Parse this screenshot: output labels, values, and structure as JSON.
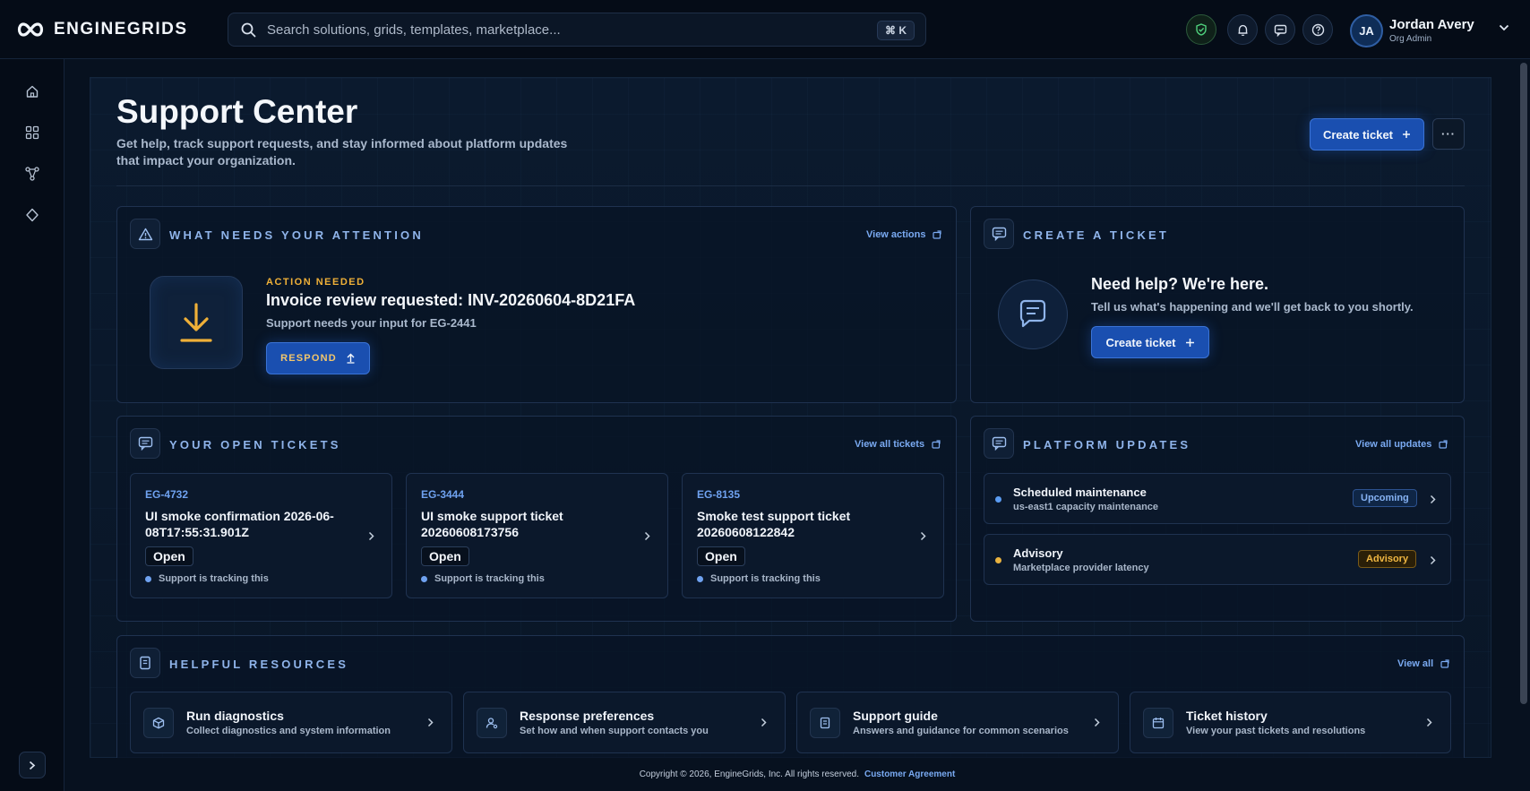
{
  "brand": {
    "name": "ENGINEGRIDS",
    "logo_icon": "infinity-logo-icon"
  },
  "search": {
    "placeholder": "Search solutions, grids, templates, marketplace...",
    "shortcut": "⌘ K"
  },
  "topbar_icons": [
    "shield-check-icon",
    "bell-icon",
    "message-icon",
    "help-icon"
  ],
  "user": {
    "initials": "JA",
    "name": "Jordan Avery",
    "role": "Org Admin"
  },
  "sidebar": {
    "items": [
      "home-icon",
      "grid-icon",
      "workflow-icon",
      "marketplace-icon"
    ],
    "expand_icon": "chevron-right-icon"
  },
  "page": {
    "title": "Support Center",
    "subtitle": "Get help, track support requests, and stay informed about platform updates that impact your organization.",
    "create_ticket": "Create ticket",
    "more": "···"
  },
  "attention": {
    "title": "WHAT NEEDS YOUR ATTENTION",
    "link": "View actions",
    "eyebrow": "ACTION NEEDED",
    "headline": "Invoice review requested: INV-20260604-8D21FA",
    "detail": "Support needs your input for EG-2441",
    "respond": "RESPOND"
  },
  "create": {
    "title": "CREATE A TICKET",
    "headline": "Need help? We're here.",
    "detail": "Tell us what's happening and we'll get back to you shortly.",
    "button": "Create ticket"
  },
  "tickets": {
    "title": "YOUR OPEN TICKETS",
    "link": "View all tickets",
    "items": [
      {
        "id": "EG-4732",
        "title": "UI smoke confirmation 2026-06-08T17:55:31.901Z",
        "status": "Open",
        "note": "Support is tracking this"
      },
      {
        "id": "EG-3444",
        "title": "UI smoke support ticket 20260608173756",
        "status": "Open",
        "note": "Support is tracking this"
      },
      {
        "id": "EG-8135",
        "title": "Smoke test support ticket 20260608122842",
        "status": "Open",
        "note": "Support is tracking this"
      }
    ]
  },
  "updates": {
    "title": "PLATFORM UPDATES",
    "link": "View all updates",
    "items": [
      {
        "title": "Scheduled maintenance",
        "detail": "us-east1 capacity maintenance",
        "badge": "Upcoming",
        "color": "#5b9cf2"
      },
      {
        "title": "Advisory",
        "detail": "Marketplace provider latency",
        "badge": "Advisory",
        "color": "#e9b23f"
      }
    ]
  },
  "resources": {
    "title": "HELPFUL RESOURCES",
    "link": "View all",
    "items": [
      {
        "title": "Run diagnostics",
        "detail": "Collect diagnostics and system information",
        "icon": "cube-icon"
      },
      {
        "title": "Response preferences",
        "detail": "Set how and when support contacts you",
        "icon": "user-settings-icon"
      },
      {
        "title": "Support guide",
        "detail": "Answers and guidance for common scenarios",
        "icon": "book-icon"
      },
      {
        "title": "Ticket history",
        "detail": "View your past tickets and resolutions",
        "icon": "calendar-icon"
      }
    ]
  },
  "footer": {
    "copyright": "Copyright © 2026, EngineGrids, Inc. All rights reserved.",
    "link": "Customer Agreement"
  },
  "colors": {
    "accent": "#1a4fb0",
    "link": "#7aaaf2",
    "warning": "#e9b23f",
    "background": "#07111f"
  }
}
